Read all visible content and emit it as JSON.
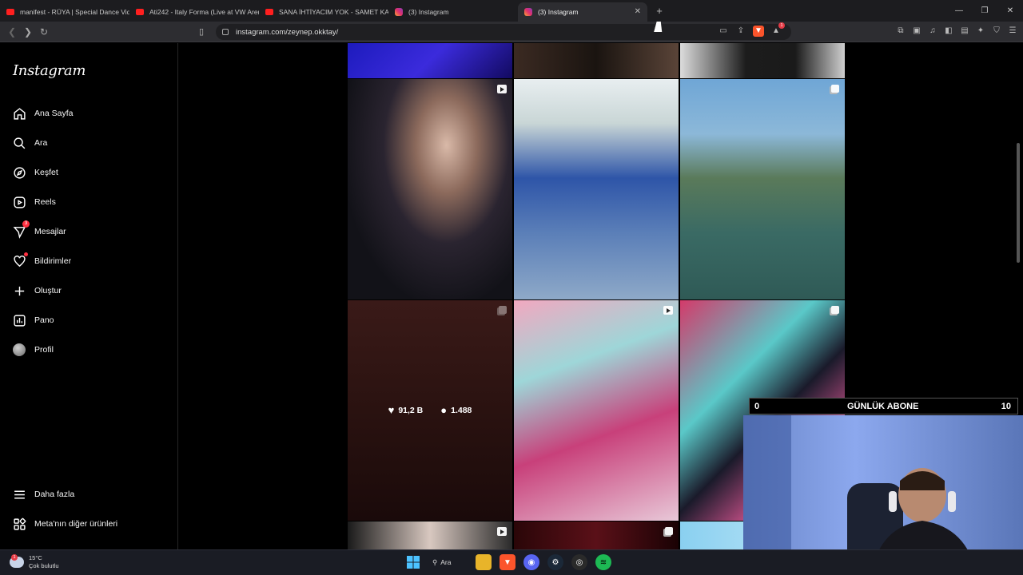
{
  "browser": {
    "tabs": [
      {
        "title": "manifest - RÜYA | Special Dance Vide",
        "favicon": "youtube-icon",
        "active": false
      },
      {
        "title": "Ati242 - Italy Forma (Live at VW Aren",
        "favicon": "youtube-icon",
        "active": false
      },
      {
        "title": "SANA İHTİYACIM YOK - SAMET KAYR",
        "favicon": "youtube-icon",
        "active": false
      },
      {
        "title": "(3) Instagram",
        "favicon": "instagram-icon",
        "active": false
      },
      {
        "title": "(3) Instagram",
        "favicon": "instagram-icon",
        "active": true
      }
    ],
    "url": "instagram.com/zeynep.okktay/",
    "brave_badge_count": "1"
  },
  "sidebar": {
    "logo": "Instagram",
    "items": [
      {
        "label": "Ana Sayfa",
        "icon": "home-icon"
      },
      {
        "label": "Ara",
        "icon": "search-icon"
      },
      {
        "label": "Keşfet",
        "icon": "compass-icon"
      },
      {
        "label": "Reels",
        "icon": "reels-icon"
      },
      {
        "label": "Mesajlar",
        "icon": "messenger-icon",
        "badge": "3"
      },
      {
        "label": "Bildirimler",
        "icon": "heart-icon",
        "dot": true
      },
      {
        "label": "Oluştur",
        "icon": "plus-icon"
      },
      {
        "label": "Pano",
        "icon": "dashboard-icon"
      },
      {
        "label": "Profil",
        "icon": "avatar-icon"
      }
    ],
    "bottom_items": [
      {
        "label": "Daha fazla",
        "icon": "hamburger-icon"
      },
      {
        "label": "Meta'nın diğer ürünleri",
        "icon": "grid-icon"
      }
    ]
  },
  "feed": {
    "hovered_post": {
      "likes": "91,2 B",
      "comments": "1.488"
    },
    "posts": [
      {
        "type": "post"
      },
      {
        "type": "post"
      },
      {
        "type": "post"
      },
      {
        "type": "reel"
      },
      {
        "type": "post"
      },
      {
        "type": "carousel"
      },
      {
        "type": "carousel"
      },
      {
        "type": "reel"
      },
      {
        "type": "carousel"
      },
      {
        "type": "reel"
      },
      {
        "type": "carousel"
      },
      {
        "type": "post"
      }
    ]
  },
  "overlay": {
    "left_count": "0",
    "label": "GÜNLÜK ABONE",
    "right_count": "10"
  },
  "taskbar": {
    "weather_temp": "15°C",
    "weather_desc": "Çok bulutlu",
    "weather_badge": "1",
    "search_label": "Ara"
  },
  "colors": {
    "accent_red": "#ff3040",
    "brave": "#fb542b",
    "sidebar_border": "#262626"
  }
}
